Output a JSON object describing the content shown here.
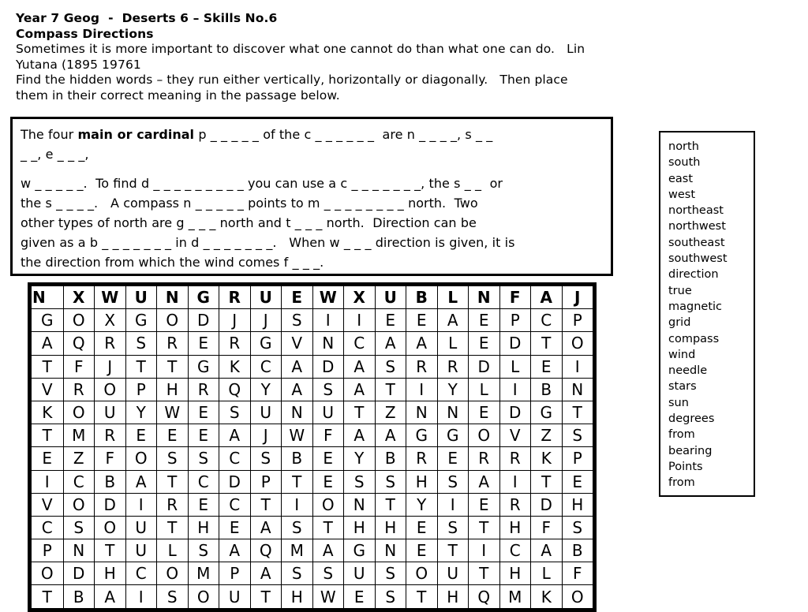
{
  "header": {
    "lines": [
      {
        "text": "Year 7 Geog  -  Deserts 6 – Skills No.6",
        "bold": true
      },
      {
        "text": "Compass Directions",
        "bold": true
      },
      {
        "text": "Sometimes it is more important to discover what one cannot do than what one can do.   Lin",
        "bold": false
      },
      {
        "text": "Yutana (1895 19761",
        "bold": false
      },
      {
        "text": "Find the hidden words – they run either vertically, horizontally or diagonally.   Then place",
        "bold": false
      },
      {
        "text": "them in their correct meaning in the passage below.",
        "bold": false
      }
    ]
  },
  "passage": {
    "lines": [
      "The four <b>main or cardinal</b> p _ _ _ _ _ of the c _ _ _ _ _ _  are n _ _ _ _, s _ _",
      "_ _, e _ _ _,",
      "",
      "w _ _ _ _ _.  To find d _ _ _ _ _ _ _ _ _ you can use a c _ _ _ _ _ _ _, the s _ _  or",
      "the s _ _ _ _.   A compass n _ _ _ _ _ points to m _ _ _ _ _ _ _ _ north.  Two",
      "other types of north are g _ _ _ north and t _ _ _ north.  Direction can be",
      "given as a b _ _ _ _ _ _ _ in d _ _ _ _ _ _ _.   When w _ _ _ direction is given, it is",
      "the direction from which the wind comes f _ _ _."
    ]
  },
  "wordlist": {
    "words": [
      "north",
      "south",
      "east",
      "west",
      "northeast",
      "northwest",
      "southeast",
      "southwest",
      "direction",
      "true",
      "magnetic",
      "grid",
      "compass",
      "wind",
      "needle",
      "stars",
      "sun",
      "degrees",
      "from",
      "bearing",
      "Points",
      "from"
    ]
  },
  "grid": {
    "rows": 14,
    "cols": 18,
    "letters": [
      [
        "N",
        "X",
        "W",
        "U",
        "N",
        "G",
        "R",
        "U",
        "E",
        "W",
        "X",
        "U",
        "B",
        "L",
        "N",
        "F",
        "A",
        "J"
      ],
      [
        "G",
        "O",
        "X",
        "G",
        "O",
        "D",
        "J",
        "J",
        "S",
        "I",
        "I",
        "E",
        "E",
        "A",
        "E",
        "P",
        "C",
        "P"
      ],
      [
        "A",
        "Q",
        "R",
        "S",
        "R",
        "E",
        "R",
        "G",
        "V",
        "N",
        "C",
        "A",
        "A",
        "L",
        "E",
        "D",
        "T",
        "O"
      ],
      [
        "T",
        "F",
        "J",
        "T",
        "T",
        "G",
        "K",
        "C",
        "A",
        "D",
        "A",
        "S",
        "R",
        "R",
        "D",
        "L",
        "E",
        "I"
      ],
      [
        "V",
        "R",
        "O",
        "P",
        "H",
        "R",
        "Q",
        "Y",
        "A",
        "S",
        "A",
        "T",
        "I",
        "Y",
        "L",
        "I",
        "B",
        "N"
      ],
      [
        "K",
        "O",
        "U",
        "Y",
        "W",
        "E",
        "S",
        "U",
        "N",
        "U",
        "T",
        "Z",
        "N",
        "N",
        "E",
        "D",
        "G",
        "T"
      ],
      [
        "T",
        "M",
        "R",
        "E",
        "E",
        "E",
        "A",
        "J",
        "W",
        "F",
        "A",
        "A",
        "G",
        "G",
        "O",
        "V",
        "Z",
        "S"
      ],
      [
        "E",
        "Z",
        "F",
        "O",
        "S",
        "S",
        "C",
        "S",
        "B",
        "E",
        "Y",
        "B",
        "R",
        "E",
        "R",
        "R",
        "K",
        "P"
      ],
      [
        "I",
        "C",
        "B",
        "A",
        "T",
        "C",
        "D",
        "P",
        "T",
        "E",
        "S",
        "S",
        "H",
        "S",
        "A",
        "I",
        "T",
        "E"
      ],
      [
        "V",
        "O",
        "D",
        "I",
        "R",
        "E",
        "C",
        "T",
        "I",
        "O",
        "N",
        "T",
        "Y",
        "I",
        "E",
        "R",
        "D",
        "H"
      ],
      [
        "C",
        "S",
        "O",
        "U",
        "T",
        "H",
        "E",
        "A",
        "S",
        "T",
        "H",
        "H",
        "E",
        "S",
        "T",
        "H",
        "F",
        "S"
      ],
      [
        "P",
        "N",
        "T",
        "U",
        "L",
        "S",
        "A",
        "Q",
        "M",
        "A",
        "G",
        "N",
        "E",
        "T",
        "I",
        "C",
        "A",
        "B"
      ],
      [
        "O",
        "D",
        "H",
        "C",
        "O",
        "M",
        "P",
        "A",
        "S",
        "S",
        "U",
        "S",
        "O",
        "U",
        "T",
        "H",
        "L",
        "F"
      ],
      [
        "T",
        "B",
        "A",
        "I",
        "S",
        "O",
        "U",
        "T",
        "H",
        "W",
        "E",
        "S",
        "T",
        "H",
        "Q",
        "M",
        "K",
        "O"
      ]
    ]
  },
  "colors": {
    "ink": "#000000",
    "paper": "#ffffff"
  }
}
